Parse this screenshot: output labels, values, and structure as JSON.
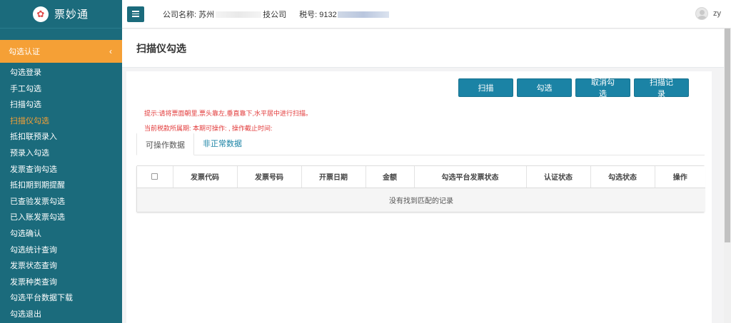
{
  "sidebar": {
    "logo_text": "票妙通",
    "section_label": "勾选认证",
    "items": [
      {
        "label": "勾选登录",
        "active": false
      },
      {
        "label": "手工勾选",
        "active": false
      },
      {
        "label": "扫描勾选",
        "active": false
      },
      {
        "label": "扫描仪勾选",
        "active": true
      },
      {
        "label": "抵扣联预录入",
        "active": false
      },
      {
        "label": "预录入勾选",
        "active": false
      },
      {
        "label": "发票查询勾选",
        "active": false
      },
      {
        "label": "抵扣期到期提醒",
        "active": false
      },
      {
        "label": "已查验发票勾选",
        "active": false
      },
      {
        "label": "已入账发票勾选",
        "active": false
      },
      {
        "label": "勾选确认",
        "active": false
      },
      {
        "label": "勾选统计查询",
        "active": false
      },
      {
        "label": "发票状态查询",
        "active": false
      },
      {
        "label": "发票种类查询",
        "active": false
      },
      {
        "label": "勾选平台数据下载",
        "active": false
      },
      {
        "label": "勾选退出",
        "active": false
      }
    ]
  },
  "header": {
    "company_label": "公司名称:",
    "company_value_start": "苏州",
    "company_value_end": "技公司",
    "tax_label": "税号:",
    "tax_value_start": "91",
    "tax_value_mid": "32",
    "username": "zy"
  },
  "page": {
    "title": "扫描仪勾选"
  },
  "toolbar": {
    "scan_label": "扫描",
    "select_label": "勾选",
    "cancel_select_label": "取消勾选",
    "scan_record_label": "扫描记录"
  },
  "tips": {
    "line1": "提示:请将票面朝里,票头靠左,垂直靠下,水平居中进行扫描。",
    "line2": "当前税款所属期: 本期可操作: , 操作截止时间:"
  },
  "tabs": [
    {
      "label": "可操作数据",
      "active": true
    },
    {
      "label": "非正常数据",
      "active": false
    }
  ],
  "table": {
    "columns": [
      "发票代码",
      "发票号码",
      "开票日期",
      "金额",
      "勾选平台发票状态",
      "认证状态",
      "勾选状态",
      "操作"
    ],
    "empty_message": "没有找到匹配的记录"
  },
  "colors": {
    "sidebar_bg": "#1b6b7c",
    "section_accent": "#f5a036",
    "button_bg": "#1b83a5",
    "tip_red": "#e23a3a"
  }
}
